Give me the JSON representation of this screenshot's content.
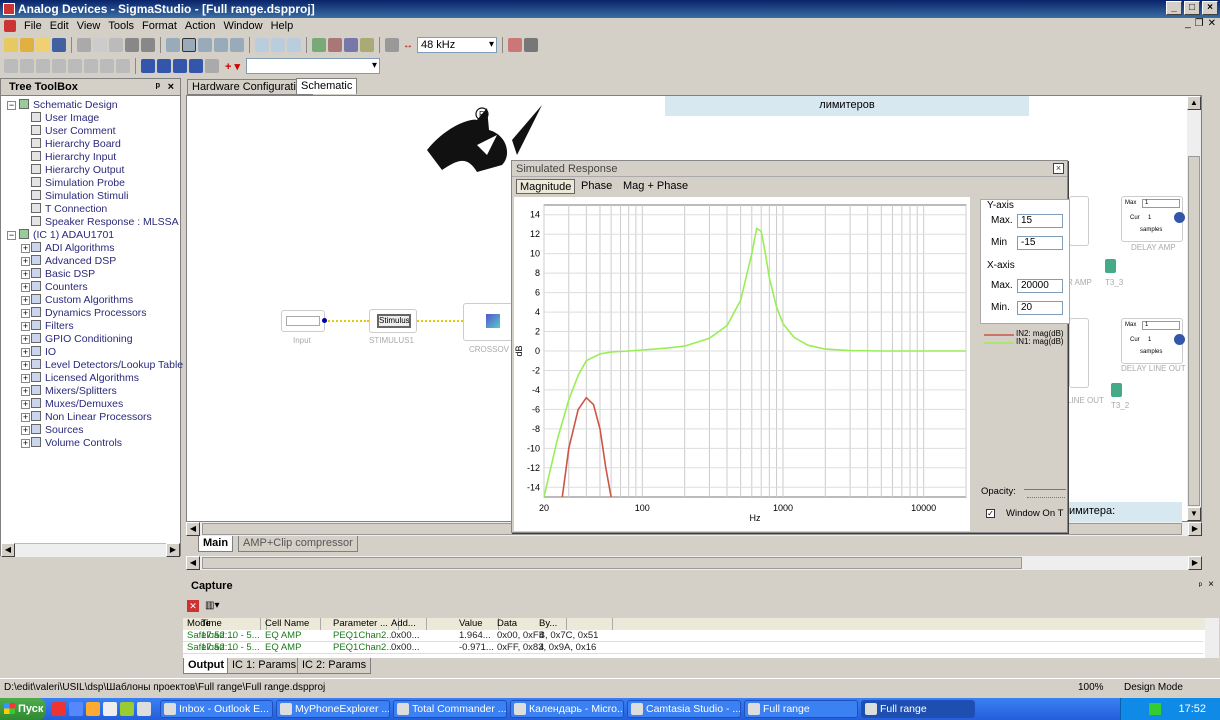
{
  "window": {
    "title": "Analog Devices - SigmaStudio - [Full range.dspproj]",
    "min": "_",
    "max": "□",
    "close": "×"
  },
  "menu": [
    "File",
    "Edit",
    "View",
    "Tools",
    "Format",
    "Action",
    "Window",
    "Help"
  ],
  "toolbar": {
    "samplerate": "48 kHz"
  },
  "toolbox": {
    "title": "Tree ToolBox",
    "pin": "ᵖ",
    "close": "×",
    "items": [
      {
        "label": "Schematic Design",
        "level": 0
      },
      {
        "label": "User Image",
        "level": 1
      },
      {
        "label": "User Comment",
        "level": 1
      },
      {
        "label": "Hierarchy Board",
        "level": 1
      },
      {
        "label": "Hierarchy Input",
        "level": 1
      },
      {
        "label": "Hierarchy Output",
        "level": 1
      },
      {
        "label": "Simulation Probe",
        "level": 1
      },
      {
        "label": "Simulation Stimuli",
        "level": 1
      },
      {
        "label": "T Connection",
        "level": 1
      },
      {
        "label": "Speaker Response : MLSSA",
        "level": 1
      },
      {
        "label": "(IC 1) ADAU1701",
        "level": 0
      },
      {
        "label": "ADI Algorithms",
        "level": 1
      },
      {
        "label": "Advanced DSP",
        "level": 1
      },
      {
        "label": "Basic DSP",
        "level": 1
      },
      {
        "label": "Counters",
        "level": 1
      },
      {
        "label": "Custom Algorithms",
        "level": 1
      },
      {
        "label": "Dynamics Processors",
        "level": 1
      },
      {
        "label": "Filters",
        "level": 1
      },
      {
        "label": "GPIO Conditioning",
        "level": 1
      },
      {
        "label": "IO",
        "level": 1
      },
      {
        "label": "Level Detectors/Lookup Table",
        "level": 1
      },
      {
        "label": "Licensed Algorithms",
        "level": 1
      },
      {
        "label": "Mixers/Splitters",
        "level": 1
      },
      {
        "label": "Muxes/Demuxes",
        "level": 1
      },
      {
        "label": "Non Linear Processors",
        "level": 1
      },
      {
        "label": "Sources",
        "level": 1
      },
      {
        "label": "Volume Controls",
        "level": 1
      }
    ]
  },
  "doc_tabs": [
    "Hardware Configuration",
    "Schematic"
  ],
  "bottom_tabs": [
    "Main",
    "AMP+Clip compressor"
  ],
  "canvas": {
    "limiters_top": "лимитеров",
    "limiters_bottom": "имитера:",
    "input_label": "Input",
    "stimulus_btn": "Stimulus",
    "stimulus_label": "STIMULUS1",
    "crossover_label": "CROSSOV",
    "delay_amp": "DELAY AMP",
    "delay_line_out": "DELAY LINE OUT",
    "t3_3": "T3_3",
    "t3_2": "T3_2",
    "r_amp": "R AMP",
    "line_out": "LINE OUT",
    "samples": "samples",
    "max": "Max",
    "cur": "Cur",
    "one": "1"
  },
  "sim": {
    "title": "Simulated Response",
    "close": "×",
    "tabs": [
      "Magnitude",
      "Phase",
      "Mag + Phase"
    ],
    "yaxis_title": "Y-axis",
    "ymax_label": "Max.",
    "ymax": "15",
    "ymin_label": "Min",
    "ymin": "-15",
    "xaxis_title": "X-axis",
    "xmax_label": "Max.",
    "xmax": "20000",
    "xmin_label": "Min.",
    "xmin": "20",
    "opacity_label": "Opacity:",
    "window_on_top": "Window On T",
    "legend": [
      "IN2: mag(dB)",
      "IN1: mag(dB)"
    ]
  },
  "chart_data": {
    "type": "line",
    "xlabel": "Hz",
    "ylabel": "dB",
    "xscale": "log",
    "xlim": [
      20,
      20000
    ],
    "ylim": [
      -15,
      15
    ],
    "xticks": [
      "20",
      "100",
      "1000",
      "10000"
    ],
    "yticks": [
      "14",
      "12",
      "10",
      "8",
      "6",
      "4",
      "2",
      "0",
      "-2",
      "-4",
      "-6",
      "-8",
      "-10",
      "-12",
      "-14"
    ],
    "grid": true,
    "series": [
      {
        "name": "IN1: mag(dB)",
        "color": "#99ee55",
        "x": [
          20,
          25,
          30,
          35,
          40,
          50,
          60,
          80,
          100,
          150,
          200,
          300,
          400,
          500,
          600,
          650,
          700,
          750,
          800,
          900,
          1000,
          1200,
          1500,
          2000,
          3000,
          5000,
          10000,
          20000
        ],
        "y": [
          -15,
          -9,
          -5,
          -2.5,
          -1,
          -0.3,
          -0.1,
          0,
          0.1,
          0.3,
          0.5,
          1.3,
          2.6,
          5.2,
          10,
          12.6,
          12.3,
          10,
          7.5,
          4.5,
          2.8,
          1.4,
          0.6,
          0.2,
          0.05,
          0,
          0,
          0
        ]
      },
      {
        "name": "IN2: mag(dB)",
        "color": "#cc5544",
        "x": [
          27,
          30,
          35,
          40,
          45,
          50,
          55,
          60
        ],
        "y": [
          -15,
          -10,
          -6,
          -4.8,
          -5.5,
          -8,
          -12,
          -15
        ]
      }
    ]
  },
  "capture": {
    "title": "Capture",
    "columns": [
      "Mode",
      "Time",
      "Cell Name",
      "Parameter ...",
      "Add...",
      "Value",
      "Data",
      "By..."
    ],
    "rows": [
      [
        "Safeload ...",
        "17:52:10 - 5...",
        "EQ AMP",
        "PEQ1Chan2...",
        "0x00...",
        "1.964...",
        "0x00, 0xFB, 0x7C, 0x51",
        "4"
      ],
      [
        "Safeload ...",
        "17:52:10 - 5...",
        "EQ AMP",
        "PEQ1Chan2...",
        "0x00...",
        "-0.971...",
        "0xFF, 0x83, 0x9A, 0x16",
        "4"
      ]
    ],
    "tabs": [
      "Output",
      "IC 1: Params",
      "IC 2: Params"
    ]
  },
  "status": {
    "path": "D:\\edit\\valeri\\USIL\\dsp\\Шаблоны проектов\\Full range\\Full range.dspproj",
    "zoom": "100%",
    "mode": "Design Mode"
  },
  "taskbar": {
    "start": "Пуск",
    "tasks": [
      "Inbox - Outlook E...",
      "MyPhoneExplorer ...",
      "Total Commander ...",
      "Календарь - Micro...",
      "Camtasia Studio - ...",
      "Full range",
      "Full range"
    ],
    "clock": "17:52"
  }
}
